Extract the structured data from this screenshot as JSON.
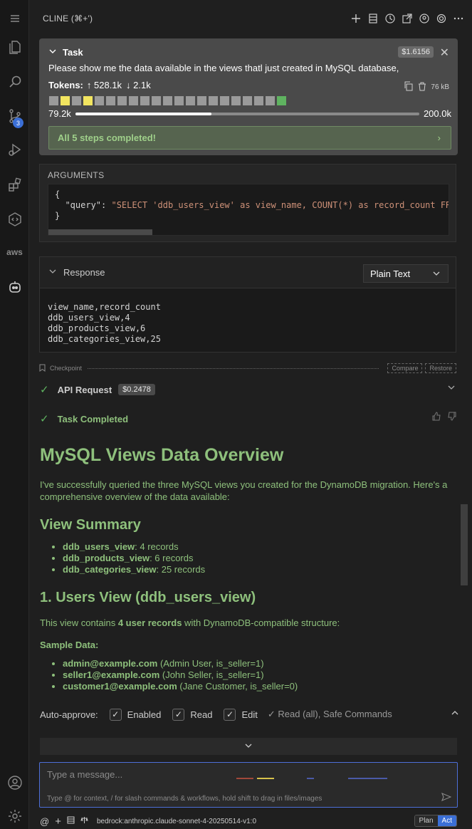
{
  "activity_bar": {
    "scm_badge": "3",
    "aws_label": "aws"
  },
  "header": {
    "title": "CLINE (⌘+')"
  },
  "task": {
    "label": "Task",
    "cost": "$1.6156",
    "text": "Please show me the data available in the views thatl just created in MySQL database,",
    "tokens_label": "Tokens:",
    "tokens_in": "↑ 528.1k",
    "tokens_out": "↓ 2.1k",
    "size": "76 kB",
    "context_used": "79.2k",
    "context_max": "200.0k",
    "context_fraction": 0.396,
    "steps": "All 5 steps completed!"
  },
  "arguments": {
    "label": "ARGUMENTS",
    "line1": "{",
    "key": "\"query\"",
    "colon": ": ",
    "value": "\"SELECT 'ddb_users_view' as view_name, COUNT(*) as record_count FR",
    "line3": "}"
  },
  "response": {
    "label": "Response",
    "format": "Plain Text",
    "body": "view_name,record_count\nddb_users_view,4\nddb_products_view,6\nddb_categories_view,25"
  },
  "checkpoint": {
    "label": "Checkpoint",
    "compare": "Compare",
    "restore": "Restore"
  },
  "api_request": {
    "label": "API Request",
    "cost": "$0.2478"
  },
  "task_completed": {
    "label": "Task Completed"
  },
  "content": {
    "h1": "MySQL Views Data Overview",
    "intro": "I've successfully queried the three MySQL views you created for the DynamoDB migration. Here's a comprehensive overview of the data available:",
    "summary_h": "View Summary",
    "summary": [
      {
        "name": "ddb_users_view",
        "rest": ": 4 records"
      },
      {
        "name": "ddb_products_view",
        "rest": ": 6 records"
      },
      {
        "name": "ddb_categories_view",
        "rest": ": 25 records"
      }
    ],
    "users_h": "1. Users View (ddb_users_view)",
    "users_p_pre": "This view contains ",
    "users_p_bold": "4 user records",
    "users_p_post": " with DynamoDB-compatible structure:",
    "sample_label": "Sample Data:",
    "samples": [
      {
        "email": "admin@example.com",
        "rest": " (Admin User, is_seller=1)"
      },
      {
        "email": "seller1@example.com",
        "rest": " (John Seller, is_seller=1)"
      },
      {
        "email": "customer1@example.com",
        "rest": " (Jane Customer, is_seller=0)"
      }
    ]
  },
  "auto_approve": {
    "label": "Auto-approve:",
    "enabled": "Enabled",
    "read": "Read",
    "edit": "Edit",
    "extra": "✓ Read (all), Safe Commands"
  },
  "input": {
    "placeholder": "Type a message...",
    "hint": "Type @ for context, / for slash commands & workflows, hold shift to drag in files/images"
  },
  "footer": {
    "model": "bedrock:anthropic.claude-sonnet-4-20250514-v1:0",
    "plan": "Plan",
    "act": "Act"
  },
  "colors": {
    "accent": "#3b6fd6",
    "success": "#8ec07c",
    "check": "#5fb360"
  }
}
